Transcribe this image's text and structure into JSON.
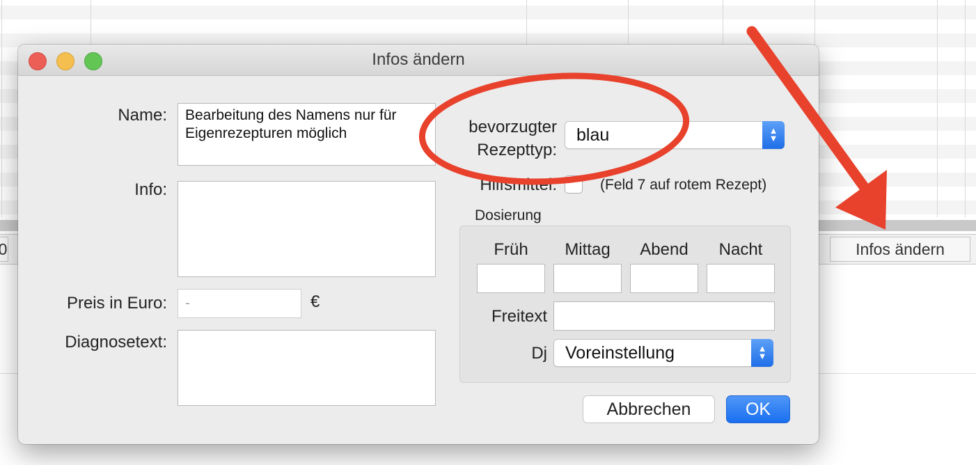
{
  "background": {
    "toolbar_button_left": "0",
    "toolbar_button_right": "Infos ändern"
  },
  "dialog": {
    "title": "Infos ändern",
    "name_label": "Name:",
    "name_value_line1": "Bearbeitung des Namens nur für",
    "name_value_line2": "Eigenrezepturen möglich",
    "info_label": "Info:",
    "info_value": "",
    "price_label": "Preis in Euro:",
    "price_placeholder": "-",
    "price_unit": "€",
    "diagnosis_label": "Diagnosetext:",
    "diagnosis_value": "",
    "rx_type_label_line1": "bevorzugter",
    "rx_type_label_line2": "Rezepttyp:",
    "rx_type_value": "blau",
    "aid_label": "Hilfsmittel:",
    "aid_checked": false,
    "aid_hint": "(Feld 7 auf rotem Rezept)",
    "dosage_group_label": "Dosierung",
    "dosage_columns": [
      "Früh",
      "Mittag",
      "Abend",
      "Nacht"
    ],
    "dosage_values": [
      "",
      "",
      "",
      ""
    ],
    "freetext_label": "Freitext",
    "freetext_value": "",
    "dj_label": "Dj",
    "dj_value": "Voreinstellung",
    "cancel_label": "Abbrechen",
    "ok_label": "OK"
  },
  "annotation": {
    "color": "#e8412c",
    "shapes": [
      "ellipse-highlight",
      "arrow"
    ]
  },
  "colors": {
    "accent": "#1a6ff0",
    "dialog_bg": "#ececec",
    "traffic_close": "#ec5f57",
    "traffic_min": "#f4bf4f",
    "traffic_max": "#62c554"
  }
}
